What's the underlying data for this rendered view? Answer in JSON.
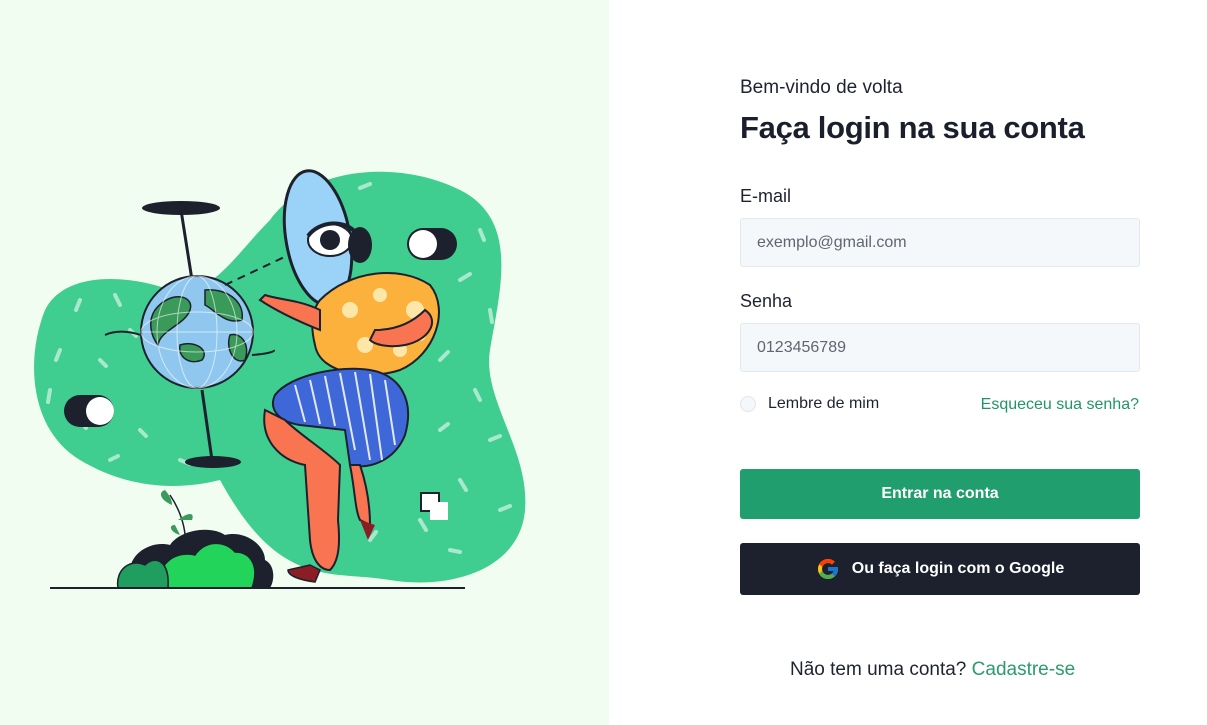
{
  "header": {
    "welcome": "Bem-vindo de volta",
    "title": "Faça login na sua conta"
  },
  "form": {
    "email_label": "E-mail",
    "email_placeholder": "exemplo@gmail.com",
    "password_label": "Senha",
    "password_placeholder": "0123456789",
    "remember_label": "Lembre de mim",
    "forgot_link": "Esqueceu sua senha?"
  },
  "buttons": {
    "login": "Entrar na conta",
    "google": "Ou faça login com o Google"
  },
  "footer": {
    "question": "Não tem uma conta?",
    "signup_link": "Cadastre-se"
  },
  "colors": {
    "left_background": "#f2fdf2",
    "accent_green": "#219e6d",
    "dark_button": "#1d212d",
    "blob_green": "#3fce8f"
  },
  "icons": {
    "google": "google-icon"
  }
}
